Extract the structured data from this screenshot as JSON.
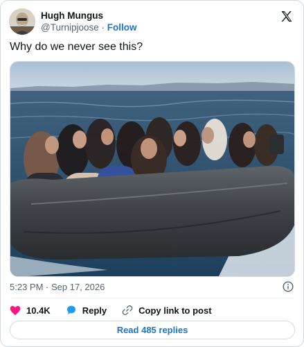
{
  "author": {
    "display_name": "Hugh Mungus",
    "handle": "@Turnipjoose",
    "separator": "·",
    "follow_label": "Follow"
  },
  "tweet": {
    "text": "Why do we never see this?",
    "timestamp": "5:23 PM · Sep 17, 2026"
  },
  "actions": {
    "like_count": "10.4K",
    "reply_label": "Reply",
    "copy_link_label": "Copy link to post"
  },
  "read_replies_label": "Read 485 replies",
  "colors": {
    "accent_blue": "#1d74c5",
    "like_pink": "#f91880",
    "muted_text": "#536471",
    "border": "#cfd9de"
  },
  "icons": {
    "brand": "x-logo-icon",
    "info": "info-icon",
    "like": "heart-icon",
    "reply": "speech-bubble-icon",
    "copy_link": "link-icon"
  }
}
